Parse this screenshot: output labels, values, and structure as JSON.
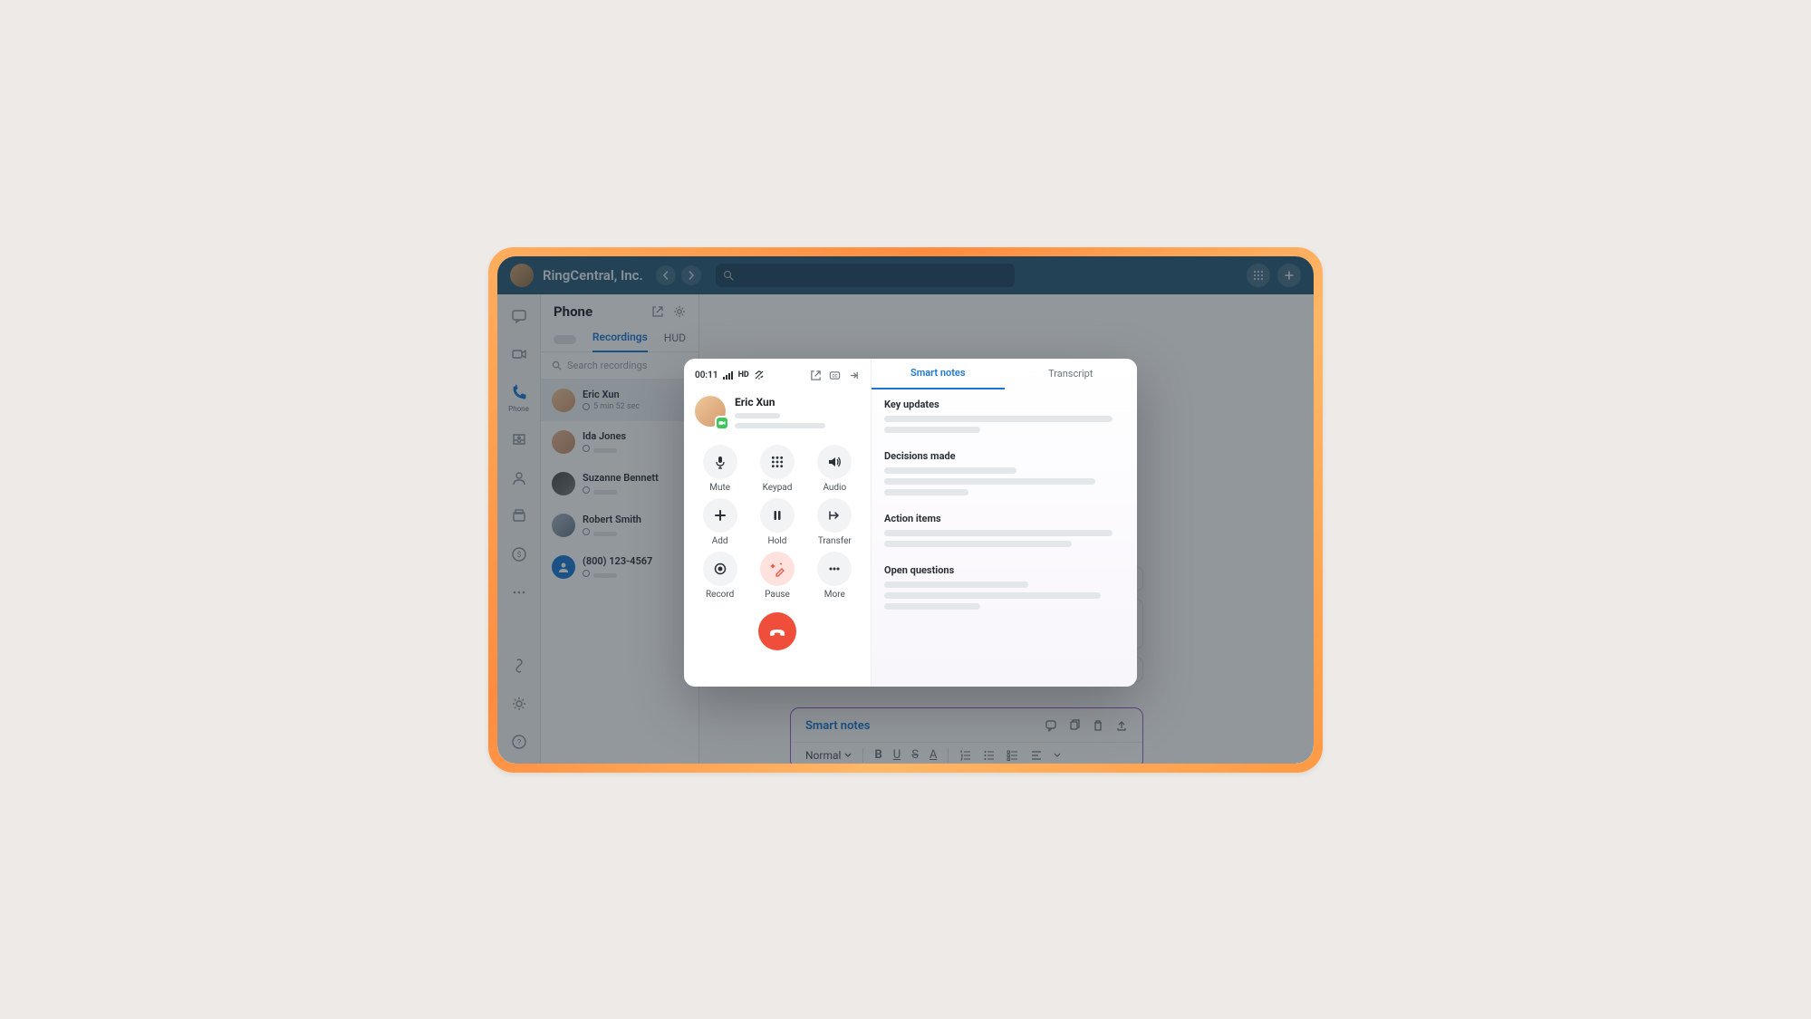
{
  "header": {
    "company": "RingCentral, Inc."
  },
  "rail": {
    "active_label": "Phone"
  },
  "list": {
    "title": "Phone",
    "tabs": {
      "recordings": "Recordings",
      "hud": "HUD"
    },
    "search_placeholder": "Search recordings",
    "items": [
      {
        "name": "Eric Xun",
        "meta": "5 min 52 sec"
      },
      {
        "name": "Ida Jones",
        "meta": ""
      },
      {
        "name": "Suzanne Bennett",
        "meta": ""
      },
      {
        "name": "Robert Smith",
        "meta": ""
      },
      {
        "name": "(800) 123-4567",
        "meta": ""
      }
    ]
  },
  "bg_notes": {
    "title": "Smart notes",
    "format": "Normal"
  },
  "call": {
    "time": "00:11",
    "hd": "HD",
    "caller": "Eric Xun",
    "buttons": {
      "mute": "Mute",
      "keypad": "Keypad",
      "audio": "Audio",
      "add": "Add",
      "hold": "Hold",
      "transfer": "Transfer",
      "record": "Record",
      "pause": "Pause",
      "more": "More"
    },
    "tabs": {
      "smart": "Smart notes",
      "transcript": "Transcript"
    },
    "sections": {
      "key_updates": "Key updates",
      "decisions": "Decisions made",
      "action_items": "Action items",
      "open_questions": "Open questions"
    }
  }
}
